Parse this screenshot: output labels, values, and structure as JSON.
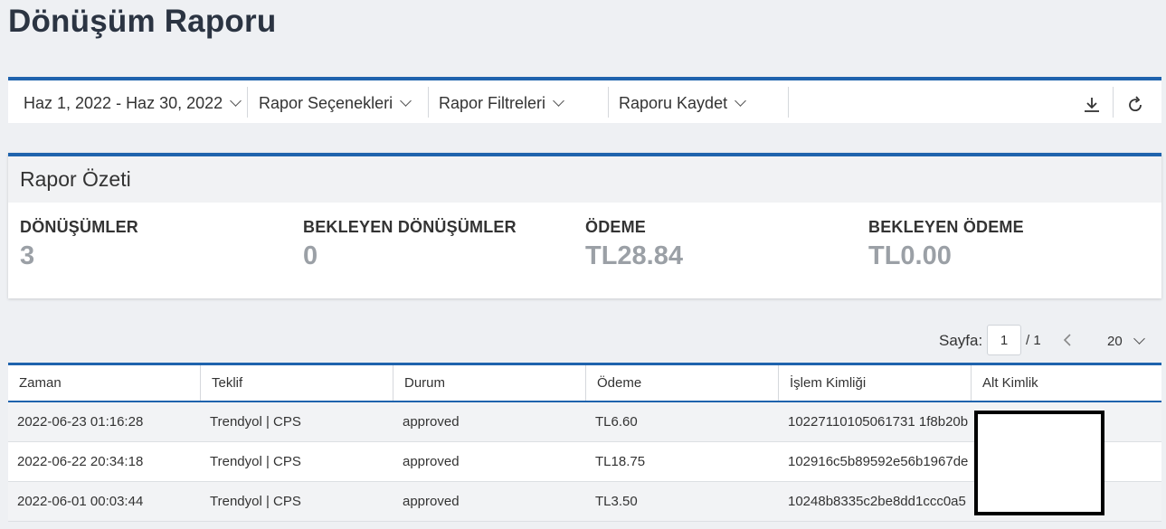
{
  "page": {
    "title": "Dönüşüm Raporu"
  },
  "toolbar": {
    "date_range": "Haz 1, 2022 - Haz 30, 2022",
    "report_options": "Rapor Seçenekleri",
    "report_filters": "Rapor Filtreleri",
    "save_report": "Raporu Kaydet",
    "icons": [
      "download-icon",
      "refresh-icon"
    ]
  },
  "summary": {
    "title": "Rapor Özeti",
    "metrics": [
      {
        "label": "DÖNÜŞÜMLER",
        "value": "3"
      },
      {
        "label": "BEKLEYEN DÖNÜŞÜMLER",
        "value": "0"
      },
      {
        "label": "ÖDEME",
        "value": "TL28.84"
      },
      {
        "label": "BEKLEYEN ÖDEME",
        "value": "TL0.00"
      }
    ]
  },
  "pager": {
    "label": "Sayfa:",
    "current_page": "1",
    "total": "/ 1",
    "page_size": "20"
  },
  "table": {
    "columns": [
      "Zaman",
      "Teklif",
      "Durum",
      "Ödeme",
      "İşlem Kimliği",
      "Alt Kimlik"
    ],
    "rows": [
      [
        "2022-06-23 01:16:28",
        "Trendyol | CPS",
        "approved",
        "TL6.60",
        "10227110105061731 1f8b20b",
        ""
      ],
      [
        "2022-06-22 20:34:18",
        "Trendyol | CPS",
        "approved",
        "TL18.75",
        "102916c5b89592e56b1967de",
        ""
      ],
      [
        "2022-06-01 00:03:44",
        "Trendyol | CPS",
        "approved",
        "TL3.50",
        "10248b8335c2be8dd1ccc0a5",
        ""
      ]
    ]
  },
  "colors": {
    "accent": "#1f63ad",
    "value_gray": "#9ba0a6",
    "background": "#eef0f3"
  }
}
